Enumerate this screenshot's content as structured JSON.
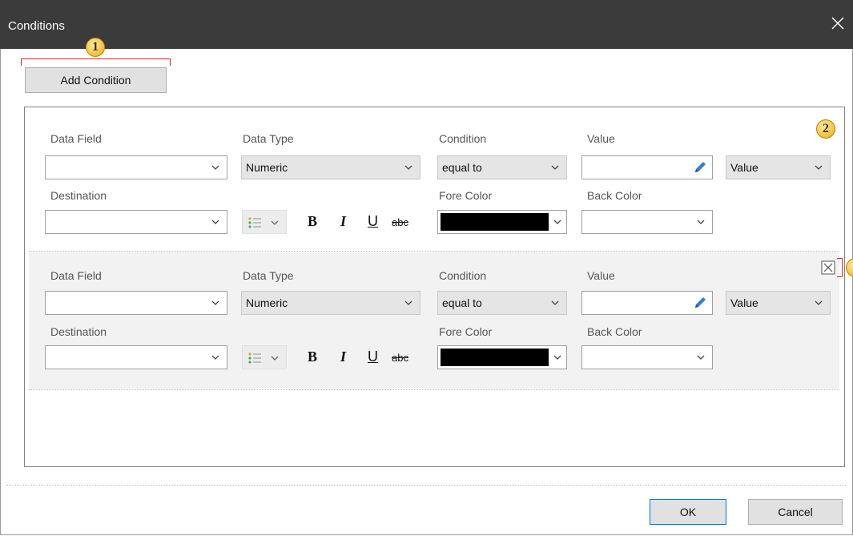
{
  "window": {
    "title": "Conditions"
  },
  "callouts": [
    "1",
    "2"
  ],
  "toolbar": {
    "add_condition_label": "Add Condition"
  },
  "labels": {
    "data_field": "Data Field",
    "data_type": "Data Type",
    "condition": "Condition",
    "value": "Value",
    "destination": "Destination",
    "fore_color": "Fore Color",
    "back_color": "Back Color"
  },
  "conditions": [
    {
      "data_field": "",
      "data_type": "Numeric",
      "condition": "equal to",
      "value": "",
      "value_mode": "Value",
      "destination": "",
      "fore_color": "#000000",
      "back_color": ""
    },
    {
      "data_field": "",
      "data_type": "Numeric",
      "condition": "equal to",
      "value": "",
      "value_mode": "Value",
      "destination": "",
      "fore_color": "#000000",
      "back_color": ""
    }
  ],
  "format": {
    "bold": "B",
    "italic": "I",
    "underline": "U",
    "strikethrough": "abc"
  },
  "footer": {
    "ok_label": "OK",
    "cancel_label": "Cancel"
  },
  "icons": [
    "close-icon",
    "chevron-down-icon",
    "pencil-icon",
    "list-icon",
    "remove-icon"
  ],
  "colors": {
    "titlebar": "#3b3b3b",
    "accent_border": "#0078d7",
    "callout_bracket": "#e02020",
    "callout_fill": "#f5c542"
  }
}
